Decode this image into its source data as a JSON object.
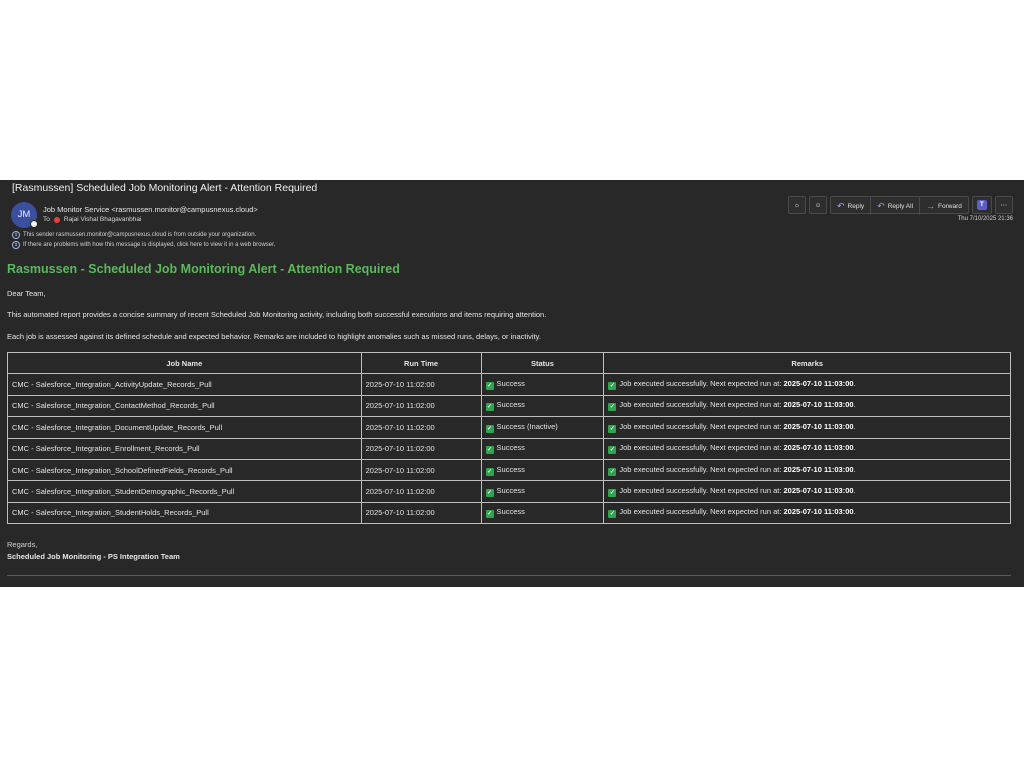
{
  "email": {
    "subject": "[Rasmussen] Scheduled Job Monitoring Alert - Attention Required",
    "avatar_initials": "JM",
    "sender": "Job Monitor Service <rasmussen.monitor@campusnexus.cloud>",
    "to_label": "To",
    "recipient": "Rajai Vishal Bhagavanbhai",
    "notice_external": "This sender rasmussen.monitor@campusnexus.cloud is from outside your organization.",
    "notice_display": "If there are problems with how this message is displayed, click here to view it in a web browser.",
    "date": "Thu 7/10/2025 21:36"
  },
  "toolbar": {
    "reply_label": "Reply",
    "reply_all_label": "Reply All",
    "forward_label": "Forward",
    "icons": [
      "brightness-icon",
      "emoji-icon",
      "reply-icon",
      "reply-all-icon",
      "forward-icon",
      "teams-icon",
      "more-icon"
    ]
  },
  "body": {
    "heading": "Rasmussen - Scheduled Job Monitoring Alert - Attention Required",
    "greeting": "Dear Team,",
    "intro": "This automated report provides a concise summary of recent Scheduled Job Monitoring activity, including both successful executions and items requiring attention.",
    "assessment": "Each job is assessed against its defined schedule and expected behavior. Remarks are included to highlight anomalies such as missed runs, delays, or inactivity.",
    "regards": "Regards,",
    "signature": "Scheduled Job Monitoring - PS Integration Team"
  },
  "table": {
    "headers": {
      "job": "Job Name",
      "run": "Run Time",
      "status": "Status",
      "remarks": "Remarks"
    },
    "remark_prefix": "Job executed successfully. Next expected run at: ",
    "rows": [
      {
        "job": "CMC - Salesforce_Integration_ActivityUpdate_Records_Pull",
        "run": "2025-07-10 11:02:00",
        "status": "Success",
        "next": "2025-07-10 11:03:00",
        "suffix": "."
      },
      {
        "job": "CMC - Salesforce_Integration_ContactMethod_Records_Pull",
        "run": "2025-07-10 11:02:00",
        "status": "Success",
        "next": "2025-07-10 11:03:00",
        "suffix": "."
      },
      {
        "job": "CMC - Salesforce_Integration_DocumentUpdate_Records_Pull",
        "run": "2025-07-10 11:02:00",
        "status": "Success (Inactive)",
        "next": "2025-07-10 11:03:00",
        "suffix": "."
      },
      {
        "job": "CMC - Salesforce_Integration_Enrollment_Records_Pull",
        "run": "2025-07-10 11:02:00",
        "status": "Success",
        "next": "2025-07-10 11:03:00",
        "suffix": "."
      },
      {
        "job": "CMC - Salesforce_Integration_SchoolDefinedFields_Records_Pull",
        "run": "2025-07-10 11:02:00",
        "status": "Success",
        "next": "2025-07-10 11:03:00",
        "suffix": "."
      },
      {
        "job": "CMC - Salesforce_Integration_StudentDemographic_Records_Pull",
        "run": "2025-07-10 11:02:00",
        "status": "Success",
        "next": "2025-07-10 11:03:00",
        "suffix": "."
      },
      {
        "job": "CMC - Salesforce_Integration_StudentHolds_Records_Pull",
        "run": "2025-07-10 11:02:00",
        "status": "Success",
        "next": "2025-07-10 11:03:00",
        "suffix": "."
      }
    ]
  },
  "colors": {
    "window_bg": "#282828",
    "heading_green": "#5cb85c",
    "check_green": "#2ea44f",
    "avatar_blue": "#3b4fa0",
    "border": "#bdbdbd"
  }
}
